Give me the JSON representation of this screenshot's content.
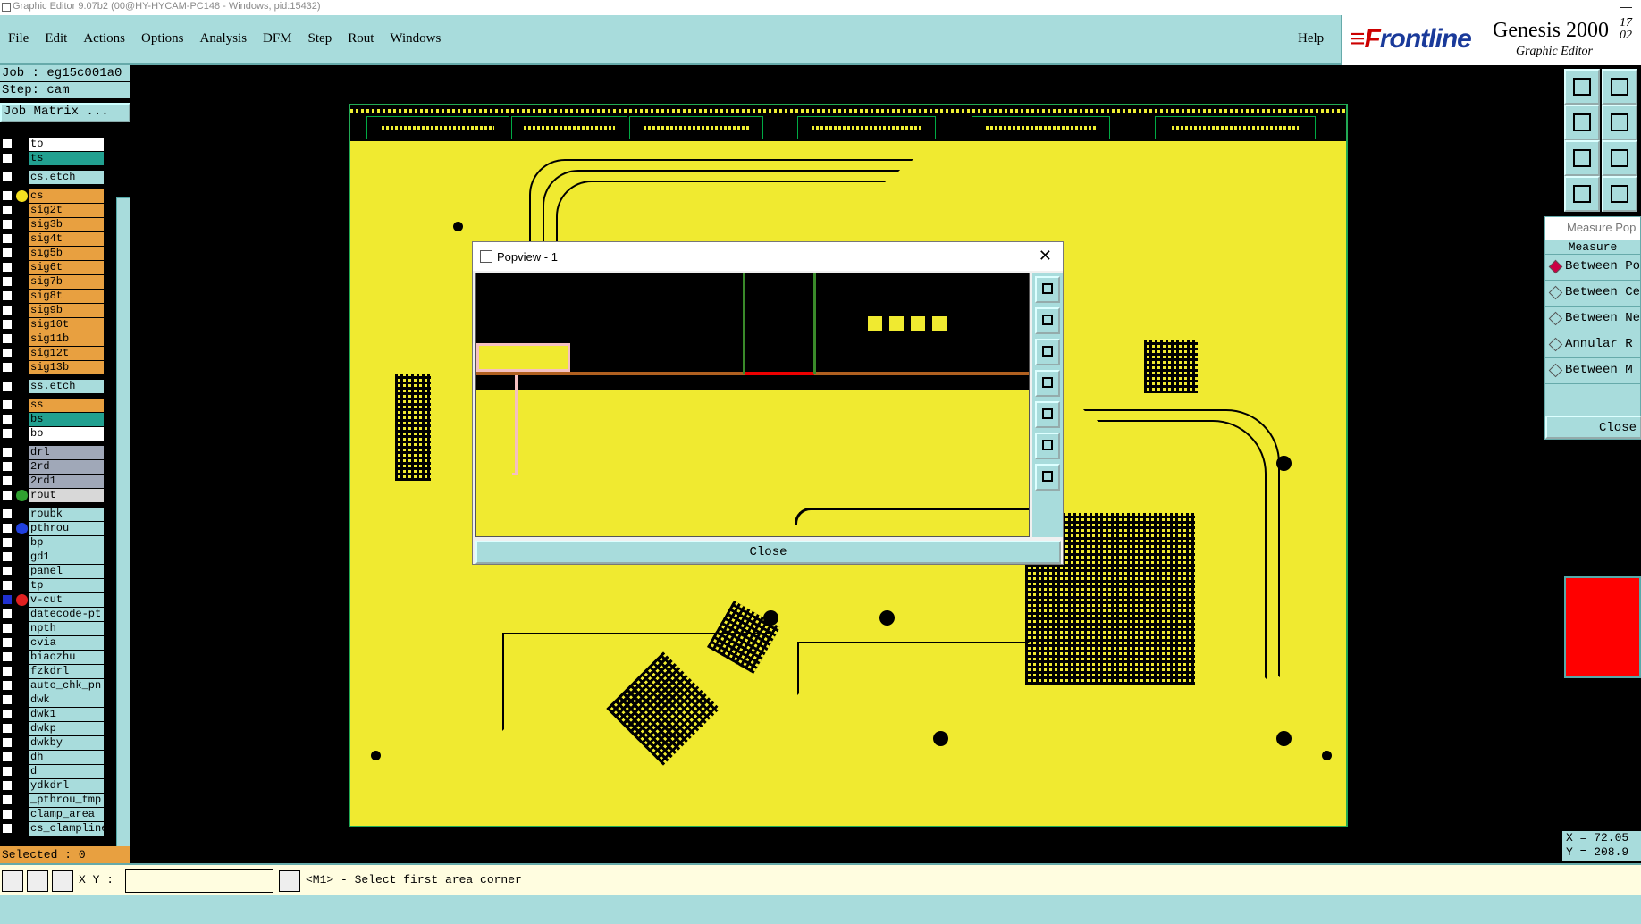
{
  "window": {
    "title": "Graphic Editor 9.07b2 (00@HY-HYCAM-PC148 - Windows, pid:15432)",
    "min": "—"
  },
  "menu": [
    "File",
    "Edit",
    "Actions",
    "Options",
    "Analysis",
    "DFM",
    "Step",
    "Rout",
    "Windows"
  ],
  "help": "Help",
  "brand": {
    "logo_a": "≡F",
    "logo_b": "rontline",
    "name": "Genesis 2000",
    "sub": "Graphic Editor",
    "ver_top": "17",
    "ver_bot": "02"
  },
  "job": {
    "job": "Job : eg15c001a0",
    "step": "Step: cam",
    "matrix": "Job Matrix ..."
  },
  "layers": [
    {
      "n": "to",
      "c": "#ffffff"
    },
    {
      "n": "ts",
      "c": "#22a090"
    },
    {
      "sep": 1
    },
    {
      "n": "cs.etch",
      "c": "#a8dcdc"
    },
    {
      "sep": 1
    },
    {
      "n": "cs",
      "c": "#e8a040",
      "dot": "#f5e020"
    },
    {
      "n": "sig2t",
      "c": "#e8a040"
    },
    {
      "n": "sig3b",
      "c": "#e8a040"
    },
    {
      "n": "sig4t",
      "c": "#e8a040"
    },
    {
      "n": "sig5b",
      "c": "#e8a040"
    },
    {
      "n": "sig6t",
      "c": "#e8a040"
    },
    {
      "n": "sig7b",
      "c": "#e8a040"
    },
    {
      "n": "sig8t",
      "c": "#e8a040"
    },
    {
      "n": "sig9b",
      "c": "#e8a040"
    },
    {
      "n": "sig10t",
      "c": "#e8a040"
    },
    {
      "n": "sig11b",
      "c": "#e8a040"
    },
    {
      "n": "sig12t",
      "c": "#e8a040"
    },
    {
      "n": "sig13b",
      "c": "#e8a040"
    },
    {
      "sep": 1
    },
    {
      "n": "ss.etch",
      "c": "#a8dcdc"
    },
    {
      "sep": 1
    },
    {
      "n": "ss",
      "c": "#e8a040"
    },
    {
      "n": "bs",
      "c": "#22a090"
    },
    {
      "n": "bo",
      "c": "#ffffff"
    },
    {
      "sep": 1
    },
    {
      "n": "drl",
      "c": "#a0a8b8"
    },
    {
      "n": "2rd",
      "c": "#a0a8b8"
    },
    {
      "n": "2rd1",
      "c": "#a0a8b8"
    },
    {
      "n": "rout",
      "c": "#d8d8d8",
      "dot": "#30a030"
    },
    {
      "sep": 1
    },
    {
      "n": "roubk",
      "c": "#a8dcdc"
    },
    {
      "n": "pthrou",
      "c": "#a8dcdc",
      "dot": "#2040e0"
    },
    {
      "n": "bp",
      "c": "#a8dcdc"
    },
    {
      "n": "gd1",
      "c": "#a8dcdc"
    },
    {
      "n": "panel",
      "c": "#a8dcdc"
    },
    {
      "n": "tp",
      "c": "#a8dcdc"
    },
    {
      "n": "v-cut",
      "c": "#a8dcdc",
      "dot": "#e02020",
      "blue": 1
    },
    {
      "n": "datecode-pt",
      "c": "#a8dcdc"
    },
    {
      "n": "npth",
      "c": "#a8dcdc"
    },
    {
      "n": "cvia",
      "c": "#a8dcdc"
    },
    {
      "n": "biaozhu",
      "c": "#a8dcdc"
    },
    {
      "n": "fzkdrl",
      "c": "#a8dcdc"
    },
    {
      "n": "auto_chk_pn",
      "c": "#a8dcdc"
    },
    {
      "n": "dwk",
      "c": "#a8dcdc"
    },
    {
      "n": "dwk1",
      "c": "#a8dcdc"
    },
    {
      "n": "dwkp",
      "c": "#a8dcdc"
    },
    {
      "n": "dwkby",
      "c": "#a8dcdc"
    },
    {
      "n": "dh",
      "c": "#a8dcdc"
    },
    {
      "n": "d",
      "c": "#a8dcdc"
    },
    {
      "n": "ydkdrl",
      "c": "#a8dcdc"
    },
    {
      "n": "_pthrou_tmp",
      "c": "#a8dcdc"
    },
    {
      "n": "clamp_area",
      "c": "#a8dcdc"
    },
    {
      "n": "cs_clampline",
      "c": "#a8dcdc"
    }
  ],
  "selected": "Selected : 0",
  "measure": {
    "title": "Measure Pop",
    "header": "Measure",
    "options": [
      "Between Po",
      "Between Ce",
      "Between Ne",
      "Annular R",
      "Between M"
    ],
    "close": "Close"
  },
  "coords": {
    "x": "X = 72.05",
    "y": "Y = 208.9"
  },
  "bottom": {
    "xy_label": "X Y :",
    "message": "<M1> - Select first area corner"
  },
  "popview": {
    "title": "Popview - 1",
    "close": "Close"
  },
  "colors": {
    "board": "#f0ea30",
    "panel": "#a8dcdc",
    "accent": "#e8a040"
  }
}
